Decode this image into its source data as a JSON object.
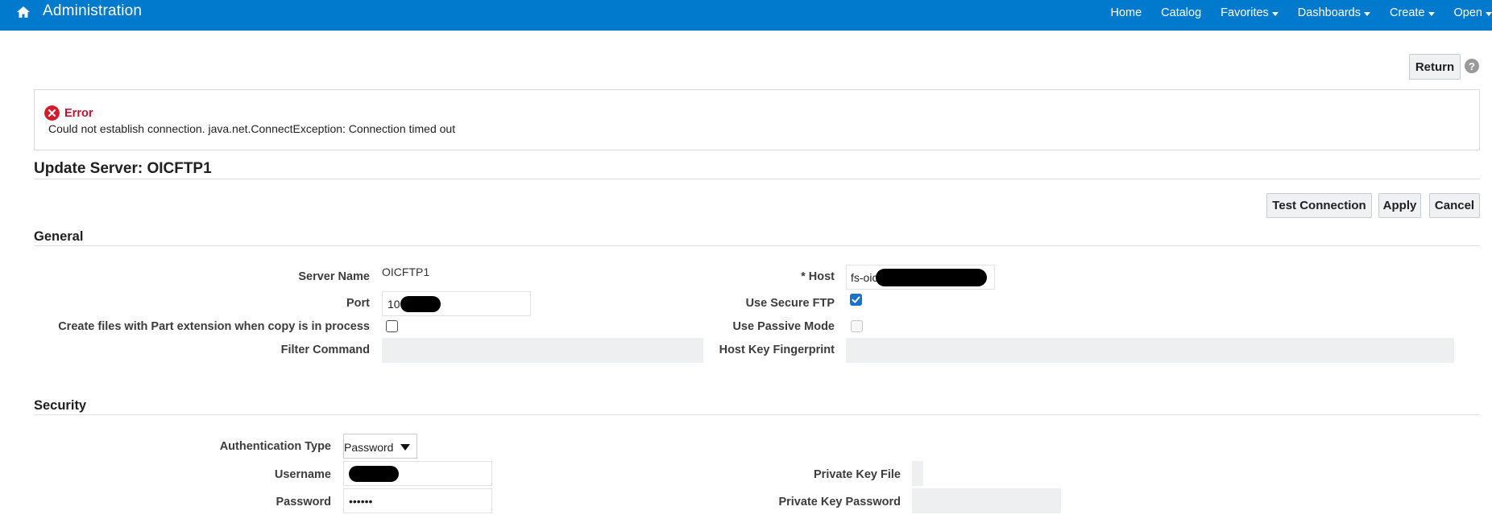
{
  "topbar": {
    "title": "Administration",
    "home_icon": "home-icon",
    "nav": [
      {
        "label": "Home",
        "dropdown": false
      },
      {
        "label": "Catalog",
        "dropdown": false
      },
      {
        "label": "Favorites",
        "dropdown": true
      },
      {
        "label": "Dashboards",
        "dropdown": true
      },
      {
        "label": "Create",
        "dropdown": true
      },
      {
        "label": "Open",
        "dropdown": true
      }
    ],
    "color": "#0179cc"
  },
  "return_button": "Return",
  "help_icon": "?",
  "error": {
    "title": "Error",
    "message": "Could not establish connection. java.net.ConnectException: Connection timed out",
    "color": "#c8102e"
  },
  "page_title": "Update Server: OICFTP1",
  "actions": {
    "test_connection": "Test Connection",
    "apply": "Apply",
    "cancel": "Cancel"
  },
  "general": {
    "heading": "General",
    "server_name_label": "Server Name",
    "server_name_value": "OICFTP1",
    "port_label": "Port",
    "port_value": "10",
    "part_extension_label": "Create files with Part extension when copy is in process",
    "part_extension_checked": false,
    "filter_command_label": "Filter Command",
    "filter_command_value": "",
    "host_label": "* Host",
    "host_value": "fs-oic",
    "secure_ftp_label": "Use Secure FTP",
    "secure_ftp_checked": true,
    "passive_mode_label": "Use Passive Mode",
    "passive_mode_checked": false,
    "host_key_label": "Host Key Fingerprint",
    "host_key_value": ""
  },
  "security": {
    "heading": "Security",
    "auth_type_label": "Authentication Type",
    "auth_type_value": "Password",
    "username_label": "Username",
    "username_value": "",
    "password_label": "Password",
    "password_value": "••••••",
    "private_key_file_label": "Private Key File",
    "private_key_password_label": "Private Key Password"
  }
}
